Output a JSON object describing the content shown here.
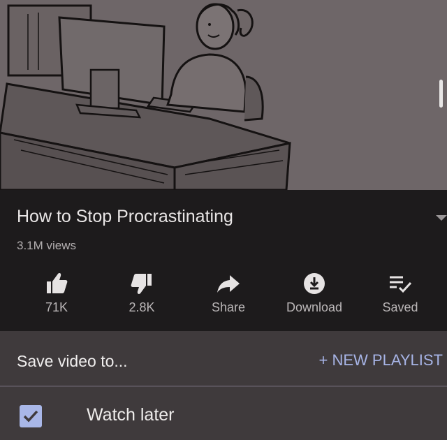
{
  "video": {
    "title": "How to Stop Procrastinating",
    "views": "3.1M views"
  },
  "actions": [
    {
      "name": "like",
      "label": "71K",
      "icon": "thumbs-up-icon"
    },
    {
      "name": "dislike",
      "label": "2.8K",
      "icon": "thumbs-down-icon"
    },
    {
      "name": "share",
      "label": "Share",
      "icon": "share-icon"
    },
    {
      "name": "download",
      "label": "Download",
      "icon": "download-icon"
    },
    {
      "name": "saved",
      "label": "Saved",
      "icon": "playlist-check-icon"
    }
  ],
  "save_sheet": {
    "title": "Save video to...",
    "new_playlist_label": "+ NEW PLAYLIST",
    "playlists": [
      {
        "label": "Watch later",
        "checked": true
      }
    ]
  },
  "colors": {
    "background": "#1d1b1c",
    "sheet": "#3f3a3c",
    "accent": "#a9b7e8"
  }
}
